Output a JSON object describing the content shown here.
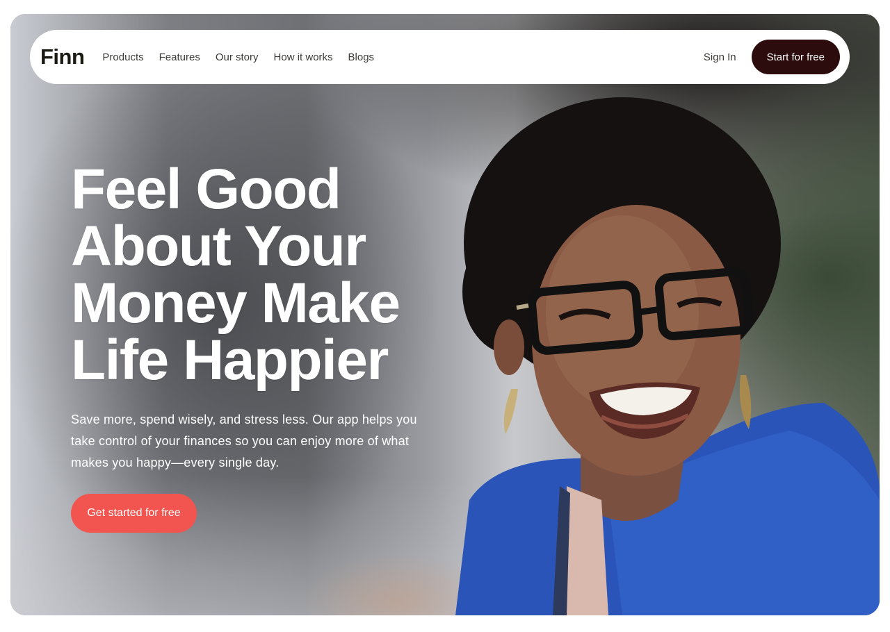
{
  "brand": {
    "logo_text": "Finn"
  },
  "nav": {
    "links": [
      "Products",
      "Features",
      "Our story",
      "How it works",
      "Blogs"
    ],
    "sign_in": "Sign In",
    "cta": "Start for free"
  },
  "hero": {
    "headline_lines": [
      "Feel Good",
      "About Your",
      "Money Make",
      "Life Happier"
    ],
    "subtext": "Save more, spend wisely, and stress less. Our app helps you take control of your finances so you can enjoy more of what makes you happy—every single day.",
    "cta": "Get started for free"
  },
  "colors": {
    "primary_cta": "#f2544f",
    "nav_cta": "#2c0c0c",
    "logo": "#1b1a12",
    "nav_text": "#3b3a36"
  }
}
